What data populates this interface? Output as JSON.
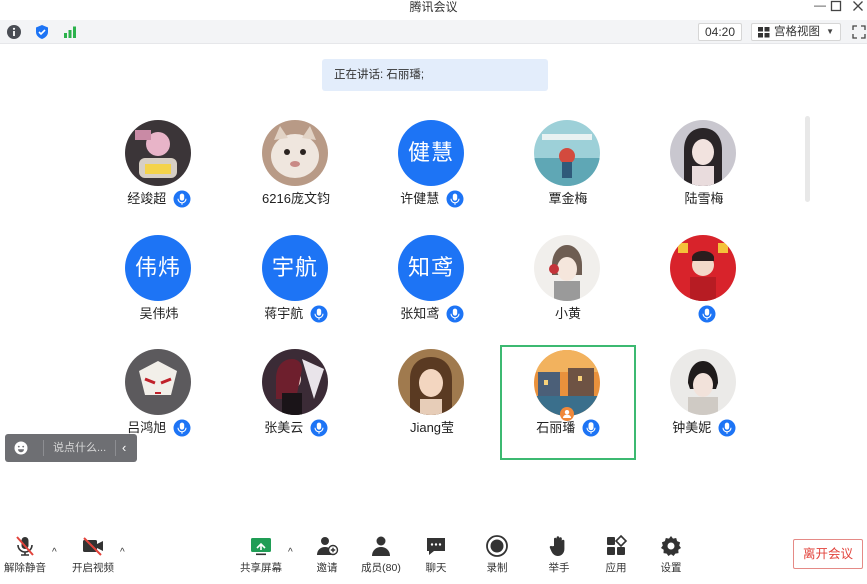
{
  "window": {
    "title": "腾讯会议",
    "controls": [
      "minimize-icon",
      "maximize-icon",
      "close-icon"
    ]
  },
  "statusbar": {
    "timer": "04:20",
    "view_label": "宫格视图",
    "icons": [
      "info-icon",
      "shield-icon",
      "signal-icon",
      "grid-icon",
      "fullscreen-icon"
    ]
  },
  "speaking": {
    "text": "正在讲话: 石丽璠;"
  },
  "participants": [
    {
      "name": "经竣超",
      "mic": true
    },
    {
      "name": "6216庞文钧",
      "mic": false
    },
    {
      "name": "许健慧",
      "mic": true,
      "avatar_text": "健慧"
    },
    {
      "name": "覃金梅",
      "mic": false
    },
    {
      "name": "陆雪梅",
      "mic": false
    },
    {
      "name": "吴伟炜",
      "mic": false,
      "avatar_text": "伟炜"
    },
    {
      "name": "蒋宇航",
      "mic": true,
      "avatar_text": "宇航"
    },
    {
      "name": "张知鸢",
      "mic": true,
      "avatar_text": "知鸢"
    },
    {
      "name": "小黄",
      "mic": false
    },
    {
      "name": "",
      "mic": true
    },
    {
      "name": "吕鸿旭",
      "mic": true
    },
    {
      "name": "张美云",
      "mic": true
    },
    {
      "name": "Jiang莹",
      "mic": false
    },
    {
      "name": "石丽璠",
      "mic": true,
      "speaking": true,
      "host": true
    },
    {
      "name": "钟美妮",
      "mic": true
    }
  ],
  "chat": {
    "placeholder": "说点什么..."
  },
  "toolbar": {
    "unmute": "解除静音",
    "start_video": "开启视频",
    "share_screen": "共享屏幕",
    "invite": "邀请",
    "members": "成员(80)",
    "chat": "聊天",
    "record": "录制",
    "raise_hand": "举手",
    "apps": "应用",
    "settings": "设置",
    "leave": "离开会议"
  },
  "colors": {
    "accent": "#1d74f5",
    "speaking_border": "#3cb971",
    "leave": "#e2433b",
    "banner": "#e3edfb"
  }
}
